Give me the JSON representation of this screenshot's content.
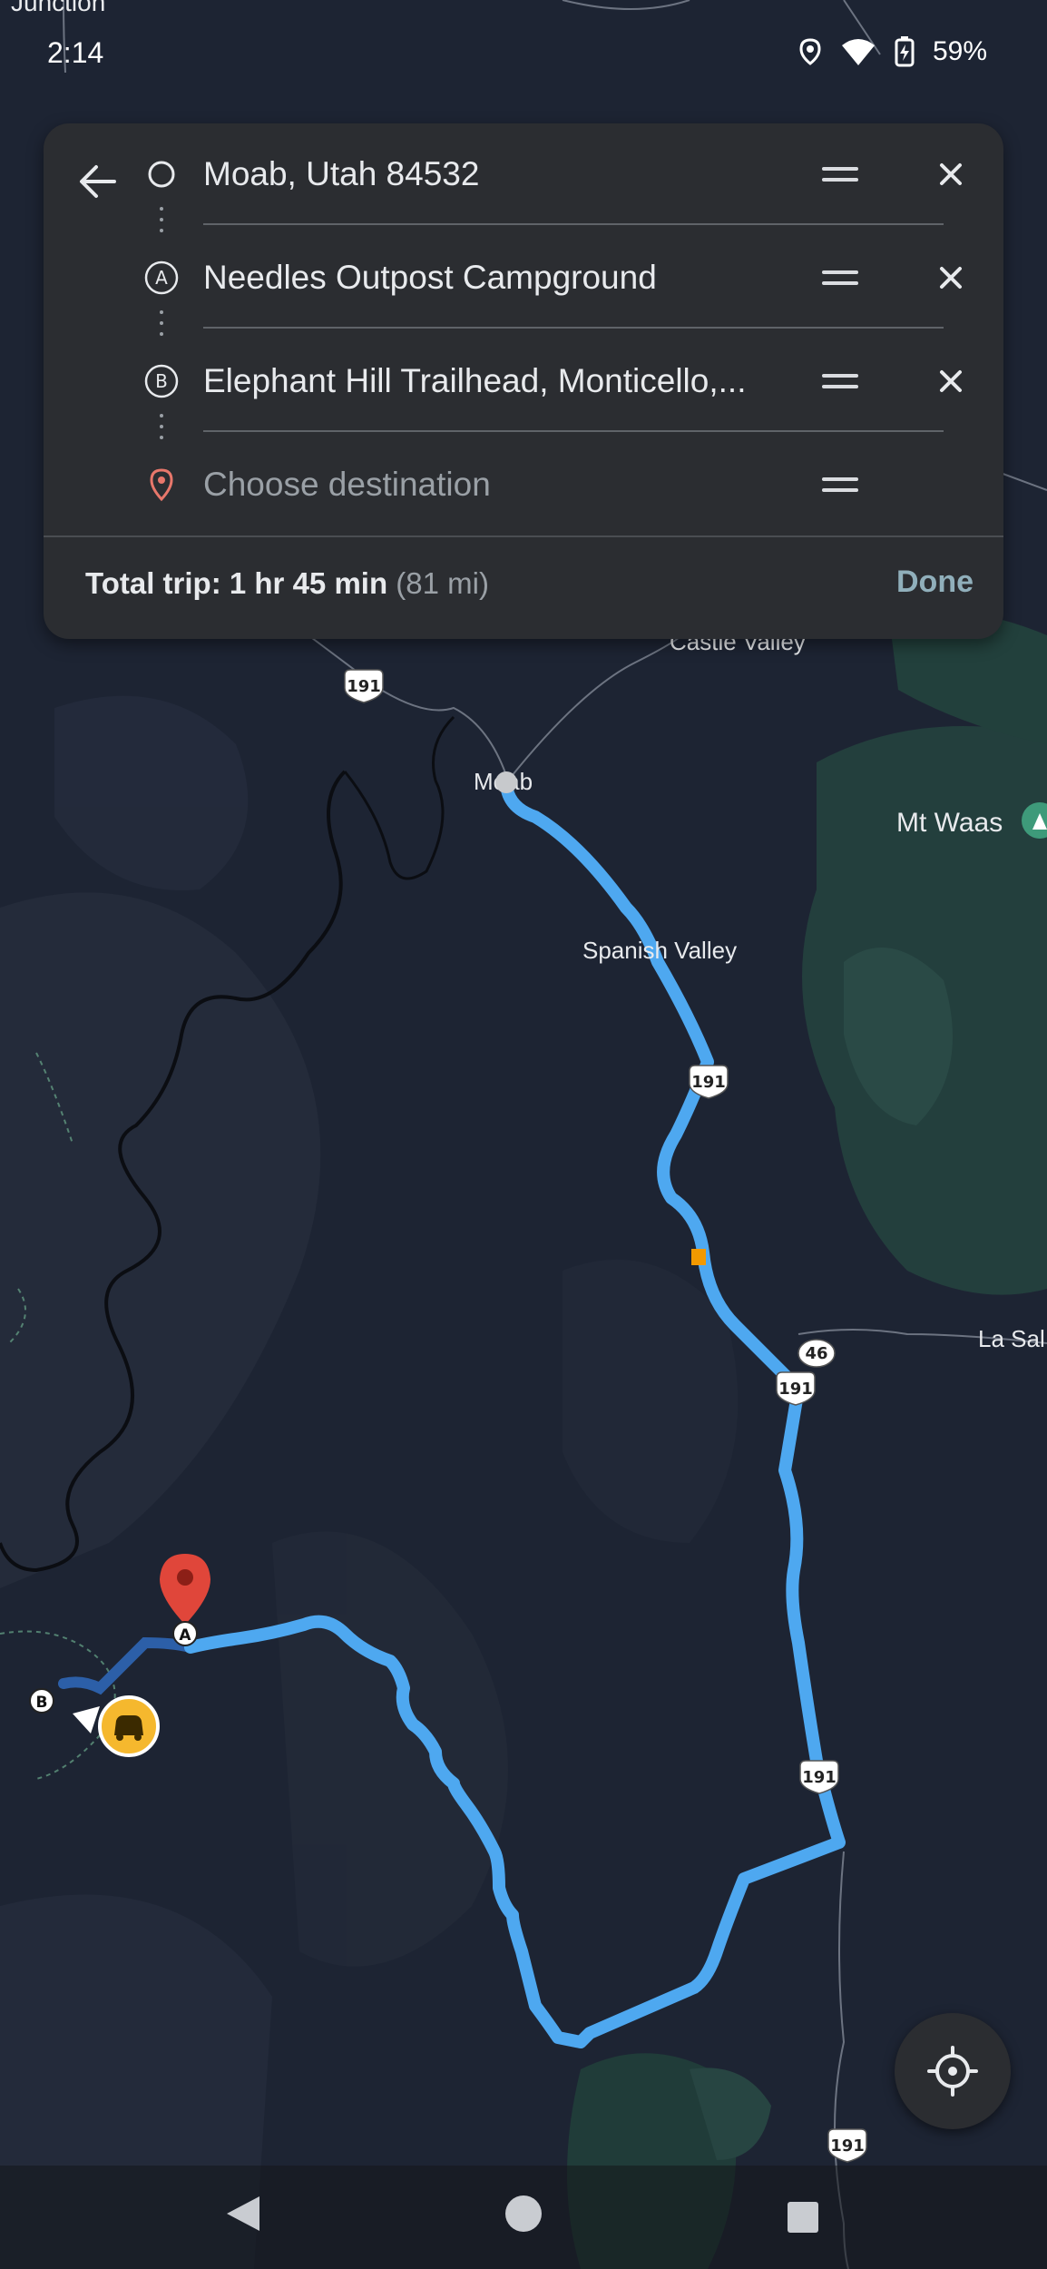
{
  "status_bar": {
    "time": "2:14",
    "battery": "59%",
    "icons": [
      "location-icon",
      "wifi-icon",
      "battery-charging-icon"
    ]
  },
  "directions": {
    "stops": [
      {
        "name": "origin",
        "text": "Moab, Utah 84532",
        "icon": "origin-circle-icon",
        "removable": true
      },
      {
        "name": "stop-a",
        "text": "Needles Outpost Campground",
        "icon": "stop-a-icon",
        "icon_letter": "A",
        "removable": true
      },
      {
        "name": "stop-b",
        "text": "Elephant Hill Trailhead, Monticello,...",
        "icon": "stop-b-icon",
        "icon_letter": "B",
        "removable": true
      },
      {
        "name": "destination",
        "placeholder": "Choose destination",
        "icon": "destination-pin-icon",
        "removable": false
      }
    ],
    "summary": {
      "label": "Total trip: ",
      "duration": "1 hr 45 min",
      "distance": "(81 mi)"
    },
    "done_label": "Done"
  },
  "map": {
    "places": [
      "Junction",
      "Castle Valley",
      "Moab",
      "Mt Waas",
      "Spanish Valley",
      "La Sal"
    ],
    "highway_shields": [
      "191",
      "191",
      "191",
      "46",
      "191",
      "191",
      "191"
    ],
    "markers": [
      {
        "label": "A",
        "type": "stop-pin"
      },
      {
        "label": "B",
        "type": "stop-marker"
      }
    ],
    "route_color": "#4ea8f0",
    "traffic_color": "#f29900"
  },
  "nav_bar": {
    "buttons": [
      "back-icon",
      "home-icon",
      "recents-icon"
    ]
  }
}
